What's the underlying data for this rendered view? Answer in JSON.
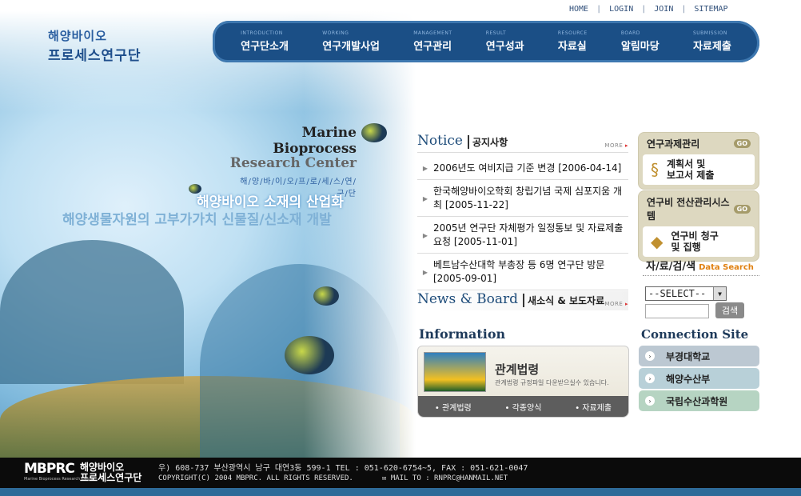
{
  "util_nav": [
    "HOME",
    "LOGIN",
    "JOIN",
    "SITEMAP"
  ],
  "logo": {
    "line1": "해양바이오",
    "line2": "프로세스연구단"
  },
  "main_nav": [
    {
      "eng": "INTRODUCTION",
      "kor": "연구단소개"
    },
    {
      "eng": "WORKING",
      "kor": "연구개발사업"
    },
    {
      "eng": "MANAGEMENT",
      "kor": "연구관리"
    },
    {
      "eng": "RESULT",
      "kor": "연구성과"
    },
    {
      "eng": "RESOURCE",
      "kor": "자료실"
    },
    {
      "eng": "BOARD",
      "kor": "알림마당"
    },
    {
      "eng": "SUBMISSION",
      "kor": "자료제출"
    }
  ],
  "hero": {
    "title1": "Marine Bioprocess",
    "title2": "Research Center",
    "title3": "해/양/바/이/오/프/로/세/스/연/구/단",
    "slogan1": "해양바이오 소재의 산업화",
    "slogan2": "해양생물자원의 고부가가치 신물질/신소재 개발"
  },
  "notice": {
    "title_en": "Notice",
    "title_kr": "공지사항",
    "more": "MORE",
    "items": [
      "2006년도 여비지급 기준 변경 [2006-04-14]",
      "한국해양바이오학회 창립기념 국제 심포지움 개최 [2005-11-22]",
      "2005년 연구단 자체평가 일정통보 및 자료제출요청 [2005-11-01]",
      "베트남수산대학 부총장 등 6명 연구단 방문 [2005-09-01]"
    ]
  },
  "news": {
    "title_en": "News & Board",
    "title_kr": "새소식 & 보도자료",
    "more": "MORE"
  },
  "information": {
    "title": "Information",
    "heading": "관계법령",
    "sub": "관계법령 규정파일 다운받으실수 있습니다.",
    "links": [
      "관계법령",
      "각종양식",
      "자료제출"
    ]
  },
  "right": {
    "box1": {
      "title": "연구과제관리",
      "go": "GO",
      "label": "계획서 및\n보고서 제출"
    },
    "box2": {
      "title": "연구비 전산관리시스템",
      "go": "GO",
      "label": "연구비 청구\n및 집행"
    },
    "data_search": {
      "title": "자/료/검/색",
      "en": "Data Search",
      "select": "--SELECT--",
      "button": "검색"
    },
    "connection": {
      "title": "Connection Site",
      "sites": [
        "부경대학교",
        "해양수산부",
        "국립수산과학원"
      ]
    }
  },
  "footer": {
    "logo_short": "MBPRC",
    "logo_sub": "Marine Bioprocess Research Center",
    "logo_kr1": "해양바이오",
    "logo_kr2": "프로세스연구단",
    "address": "우) 608-737 부산광역시 남구 대연3동 599-1  TEL : 051-620-6754~5, FAX : 051-621-0047",
    "copyright": "COPYRIGHT(C) 2004 MBPRC. ALL RIGHTS RESERVED.",
    "mail": "MAIL TO : RNPRC@HANMAIL.NET"
  },
  "colors": {
    "nav_bg": "#1b4f86",
    "notice_title": "#1e4c7a",
    "right_box": "#ddd8c0",
    "footer": "#0b0b0b"
  }
}
